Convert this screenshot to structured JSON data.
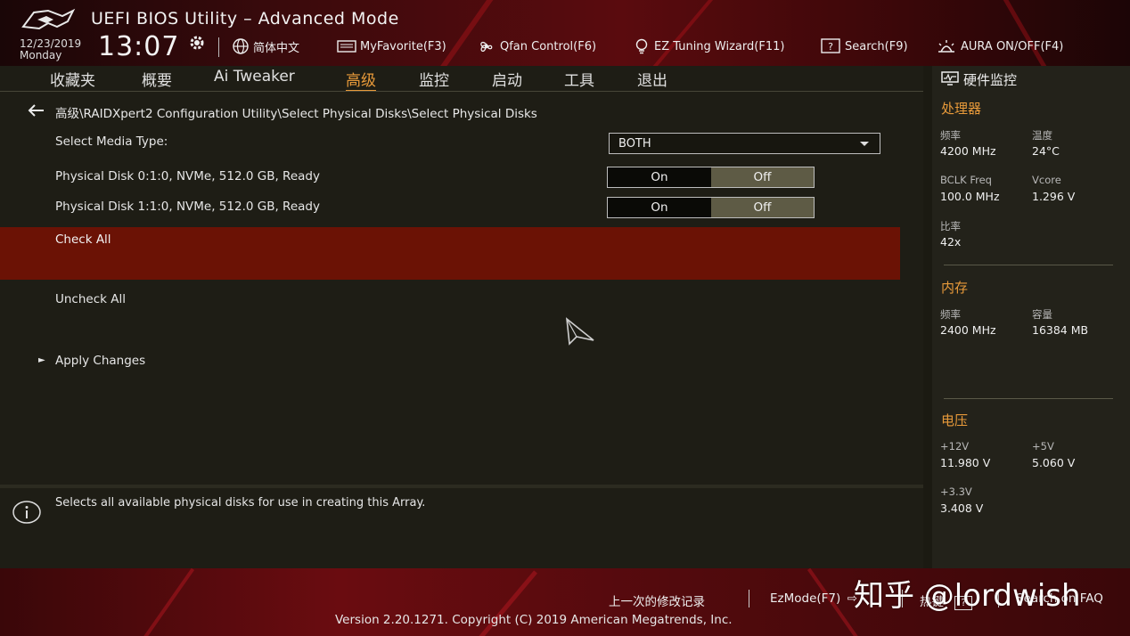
{
  "header": {
    "title": "UEFI BIOS Utility – Advanced Mode",
    "date": "12/23/2019",
    "weekday": "Monday",
    "time": "13:07",
    "items": [
      {
        "label": "简体中文",
        "icon": "globe-icon"
      },
      {
        "label": "MyFavorite(F3)",
        "icon": "keyboard-icon"
      },
      {
        "label": "Qfan Control(F6)",
        "icon": "fan-icon"
      },
      {
        "label": "EZ Tuning Wizard(F11)",
        "icon": "lightbulb-icon"
      },
      {
        "label": "Search(F9)",
        "icon": "search-help-icon"
      },
      {
        "label": "AURA ON/OFF(F4)",
        "icon": "aura-icon"
      }
    ]
  },
  "tabs": [
    "收藏夹",
    "概要",
    "Ai Tweaker",
    "高级",
    "监控",
    "启动",
    "工具",
    "退出"
  ],
  "active_tab": "高级",
  "breadcrumb": "高级\\RAIDXpert2 Configuration Utility\\Select Physical Disks\\Select Physical Disks",
  "settings": {
    "media_type_label": "Select Media Type:",
    "media_type_value": "BOTH",
    "disk0_label": "Physical Disk 0:1:0, NVMe, 512.0 GB, Ready",
    "disk1_label": "Physical Disk 1:1:0, NVMe, 512.0 GB, Ready",
    "on_label": "On",
    "off_label": "Off",
    "check_all": "Check All",
    "uncheck_all": "Uncheck All",
    "apply_changes": "Apply Changes"
  },
  "help_text": "Selects all available physical disks for use in creating this Array.",
  "monitor": {
    "title": "硬件监控",
    "cpu": {
      "section": "处理器",
      "freq_k": "频率",
      "freq_v": "4200 MHz",
      "temp_k": "温度",
      "temp_v": "24°C",
      "bclk_k": "BCLK Freq",
      "bclk_v": "100.0 MHz",
      "vcore_k": "Vcore",
      "vcore_v": "1.296 V",
      "ratio_k": "比率",
      "ratio_v": "42x"
    },
    "memory": {
      "section": "内存",
      "freq_k": "频率",
      "freq_v": "2400 MHz",
      "cap_k": "容量",
      "cap_v": "16384 MB"
    },
    "voltage": {
      "section": "电压",
      "v12_k": "+12V",
      "v12_v": "11.980 V",
      "v5_k": "+5V",
      "v5_v": "5.060 V",
      "v33_k": "+3.3V",
      "v33_v": "3.408 V"
    }
  },
  "footer": {
    "last_changes": "上一次的修改记录",
    "ezmode": "EzMode(F7)",
    "hotkeys": "热键",
    "hotkeys_key": "?",
    "search_faq": "Search on FAQ",
    "version": "Version 2.20.1271. Copyright (C) 2019 American Megatrends, Inc."
  },
  "watermark": "知乎 @lordwish",
  "colors": {
    "accent_orange": "#e89a3a",
    "selected_row": "#6b1205",
    "off_toggle": "#5e5b45"
  }
}
